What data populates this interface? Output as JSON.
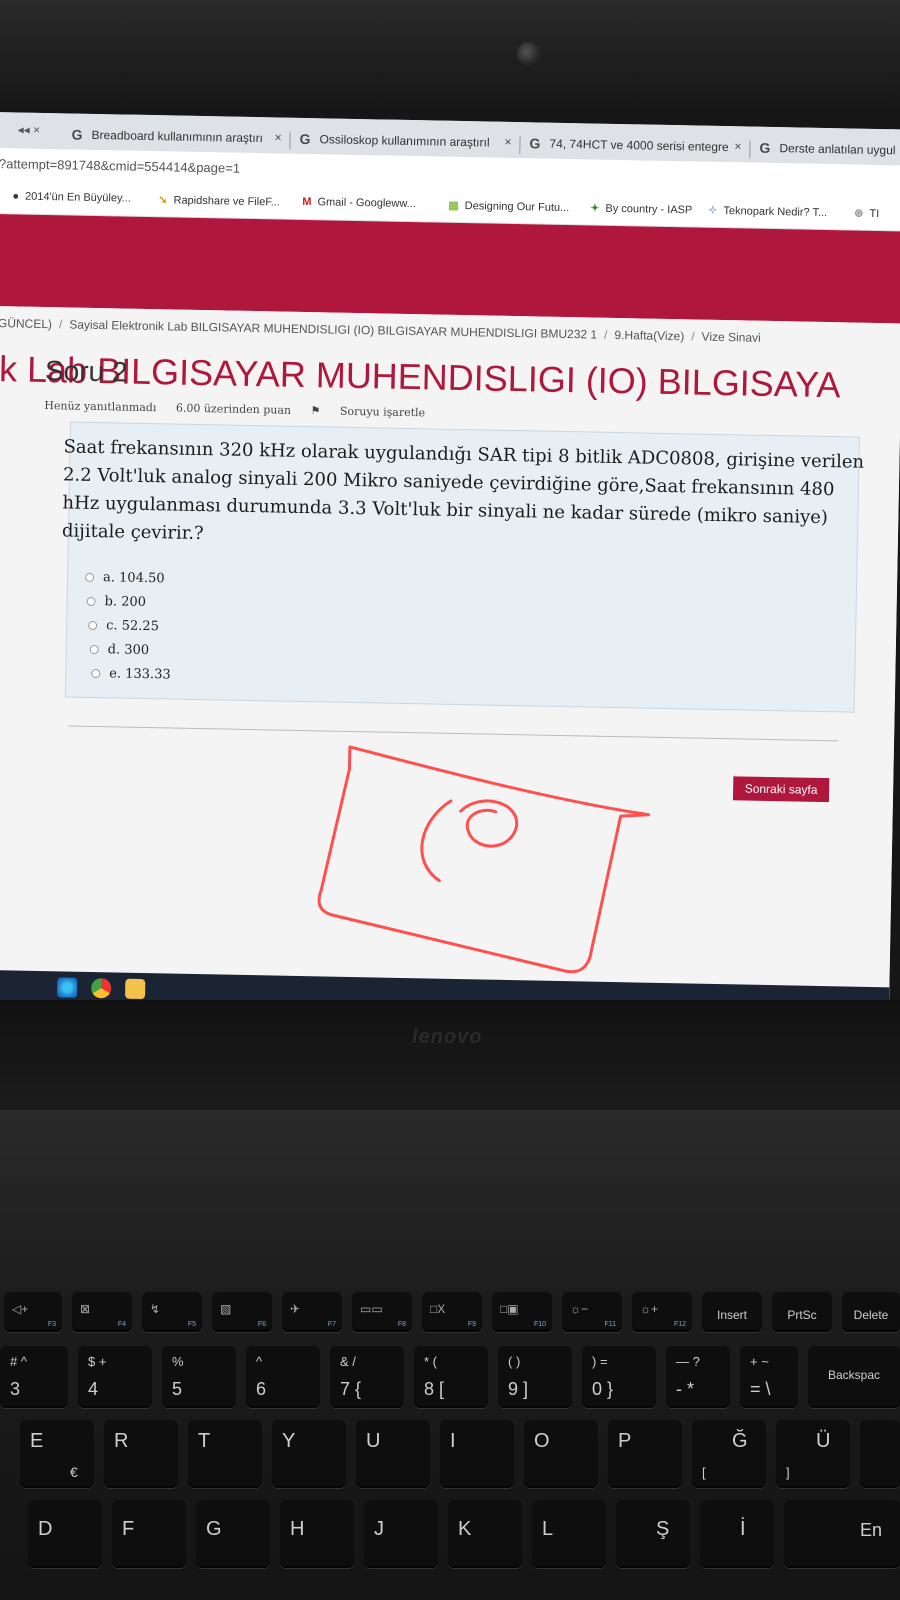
{
  "browser": {
    "tabs": [
      {
        "label": "Breadboard kullanımının araştırı"
      },
      {
        "label": "Ossiloskop kullanımının araştırıl"
      },
      {
        "label": "74, 74HCT ve 4000 serisi entegre"
      },
      {
        "label": "Derste anlatılan uygul"
      }
    ],
    "tab_close": "×",
    "tab_icon": "G",
    "nav": "◂◂ ×",
    "url": "?attempt=891748&cmid=554414&page=1",
    "bookmarks": [
      {
        "icon": "●",
        "label": "2014'ün En Büyüley..."
      },
      {
        "icon": "➘",
        "label": "Rapidshare ve FileF..."
      },
      {
        "icon": "M",
        "label": "Gmail - Googleww..."
      },
      {
        "icon": "▦",
        "label": "Designing Our Futu..."
      },
      {
        "icon": "✦",
        "label": "By country - IASP"
      },
      {
        "icon": "✧",
        "label": "Teknopark Nedir? T..."
      },
      {
        "icon": "⊛",
        "label": "TI"
      }
    ]
  },
  "page": {
    "breadcrumb": [
      "GÜNCEL)",
      "Sayisal Elektronik Lab BILGISAYAR MUHENDISLIGI (IO) BILGISAYAR MUHENDISLIGI BMU232 1",
      "9.Hafta(Vize)",
      "Vize Sinavi"
    ],
    "breadcrumb_sep": "/",
    "course_title": "ik Lab BILGISAYAR MUHENDISLIGI (IO) BILGISAYA",
    "question": {
      "title": "Soru 2",
      "status": "Henüz yanıtlanmadı",
      "points": "6.00 üzerinden puan",
      "flag": "Soruyu işaretle",
      "flag_icon": "⚑",
      "text": "Saat frekansının 320 kHz olarak uygulandığı SAR tipi 8 bitlik ADC0808, girişine verilen 2.2 Volt'luk analog sinyali 200 Mikro saniyede çevirdiğine göre,Saat frekansının 480 hHz uygulanması durumunda 3.3 Volt'luk bir sinyali ne kadar sürede (mikro saniye) dijitale çevirir.?",
      "options": [
        "a. 104.50",
        "b. 200",
        "c. 52.25",
        "d. 300",
        "e. 133.33"
      ]
    },
    "next_button": "Sonraki sayfa"
  },
  "keyboard": {
    "brand": "lenovo",
    "fkeys": [
      {
        "sym": "◁+",
        "fn": "F3"
      },
      {
        "sym": "⊠",
        "fn": "F4"
      },
      {
        "sym": "↯",
        "fn": "F5"
      },
      {
        "sym": "▧",
        "fn": "F6"
      },
      {
        "sym": "✈",
        "fn": "F7"
      },
      {
        "sym": "▭▭",
        "fn": "F8"
      },
      {
        "sym": "□X",
        "fn": "F9"
      },
      {
        "sym": "□▣",
        "fn": "F10"
      },
      {
        "sym": "☼−",
        "fn": "F11"
      },
      {
        "sym": "☼+",
        "fn": "F12"
      }
    ],
    "special": {
      "insert": "Insert",
      "prtsc": "PrtSc",
      "delete": "Delete",
      "backspace": "Backspac"
    },
    "numbers": [
      {
        "top": "#  ^",
        "main": "3"
      },
      {
        "top": "$  +",
        "main": "4"
      },
      {
        "top": "%",
        "main": "5"
      },
      {
        "top": "^",
        "main": "6"
      },
      {
        "top": "&  /",
        "main": "7  {"
      },
      {
        "top": "*  (",
        "main": "8  ["
      },
      {
        "top": "(  )",
        "main": "9  ]"
      },
      {
        "top": ")  =",
        "main": "0  }"
      },
      {
        "top": "—  ?",
        "main": "-  *"
      },
      {
        "top": "+  ~",
        "main": "=  \\"
      }
    ],
    "row_top": [
      "E",
      "R",
      "T",
      "Y",
      "U",
      "I",
      "O",
      "P",
      "Ğ",
      "Ü"
    ],
    "row_top_alt": {
      "e_alt": "€",
      "p_alt": "[",
      "g_alt": "]"
    },
    "row_home": [
      "D",
      "F",
      "G",
      "H",
      "J",
      "K",
      "L",
      "Ş",
      "İ",
      "En"
    ]
  }
}
